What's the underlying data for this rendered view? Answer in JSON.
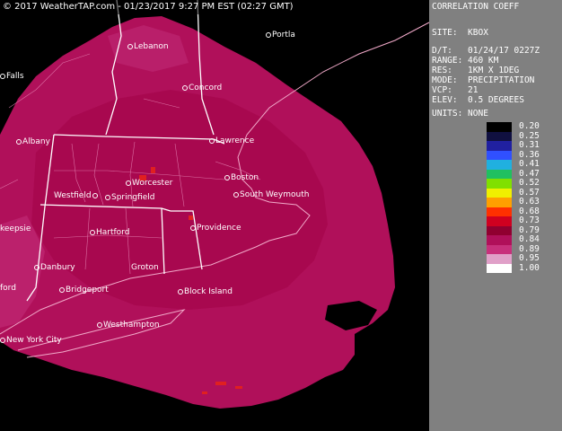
{
  "banner": "© 2017 WeatherTAP.com - 01/23/2017  9:27 PM EST (02:27 GMT)",
  "panel": {
    "product": "CORRELATION COEFF",
    "site": "SITE:  KBOX",
    "dt": "D/T:   01/24/17 0227Z",
    "range": "RANGE: 460 KM",
    "res": "RES:   1KM X 1DEG",
    "mode": "MODE:  PRECIPITATION",
    "vcp": "VCP:   21",
    "elev": "ELEV:  0.5 DEGREES",
    "units": "UNITS: NONE"
  },
  "scale": [
    {
      "label": "0.20",
      "color": "#000000"
    },
    {
      "label": "0.25",
      "color": "#101040"
    },
    {
      "label": "0.31",
      "color": "#2020a0"
    },
    {
      "label": "0.36",
      "color": "#3050ff"
    },
    {
      "label": "0.41",
      "color": "#20b0e0"
    },
    {
      "label": "0.47",
      "color": "#20c060"
    },
    {
      "label": "0.52",
      "color": "#80e000"
    },
    {
      "label": "0.57",
      "color": "#f0f000"
    },
    {
      "label": "0.63",
      "color": "#ffa000"
    },
    {
      "label": "0.68",
      "color": "#ff3000"
    },
    {
      "label": "0.73",
      "color": "#d00020"
    },
    {
      "label": "0.79",
      "color": "#900030"
    },
    {
      "label": "0.84",
      "color": "#b0105a"
    },
    {
      "label": "0.89",
      "color": "#c8307c"
    },
    {
      "label": "0.95",
      "color": "#e0a0c8"
    },
    {
      "label": "1.00",
      "color": "#ffffff"
    }
  ],
  "cities": {
    "lebanon": "Lebanon",
    "portland": "Portla",
    "falls": "Falls",
    "concord": "Concord",
    "albany": "Albany",
    "lawrence": "Lawrence",
    "worcester": "Worcester",
    "boston": "Boston",
    "westfield": "Westfield",
    "springfield": "Springfield",
    "south_weymouth": "South Weymouth",
    "poughkeepsie": "keepsie",
    "hartford": "Hartford",
    "providence": "Providence",
    "danbury": "Danbury",
    "groton": "Groton",
    "ford": "ford",
    "bridgeport": "Bridgeport",
    "block_island": "Block Island",
    "westhampton": "Westhampton",
    "new_york": "New York City"
  },
  "colors": {
    "echo": "#b0105a",
    "echo_light": "#c02a74",
    "echo_core": "#a8084f",
    "hot": "#e02020",
    "panel_bg": "#808080"
  }
}
